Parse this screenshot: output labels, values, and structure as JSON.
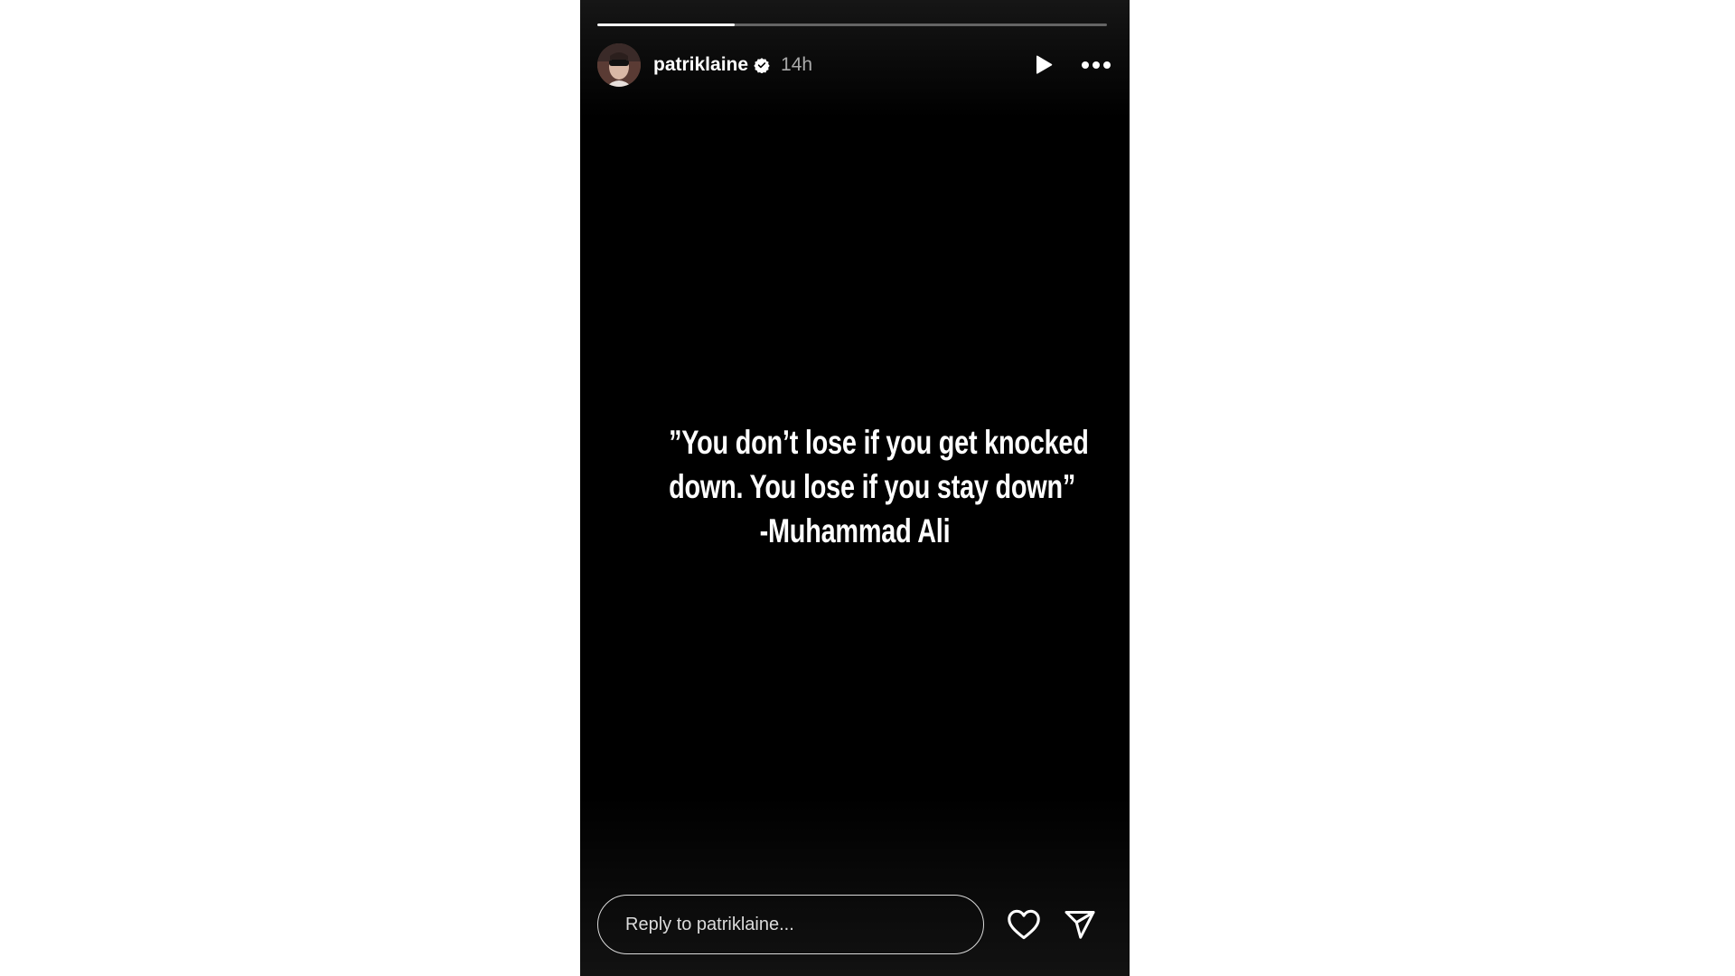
{
  "story": {
    "progress_fraction": 0.27,
    "author": {
      "username": "patriklaine",
      "verified": true,
      "time_ago": "14h",
      "avatar_icon": "profile-photo"
    },
    "quote_lines": [
      "”You don’t lose if you get knocked",
      "down. You lose if you stay down”",
      "-Muhammad Ali"
    ],
    "reply": {
      "placeholder": "Reply to patriklaine...",
      "value": ""
    },
    "icons": {
      "play": "play-icon",
      "more": "more-horizontal-icon",
      "like": "heart-icon",
      "share": "send-icon",
      "verified": "verified-badge-icon"
    },
    "colors": {
      "background": "#000000",
      "page_background": "#ffffff",
      "text": "#ffffff",
      "verified_badge": "#ffffff"
    }
  }
}
